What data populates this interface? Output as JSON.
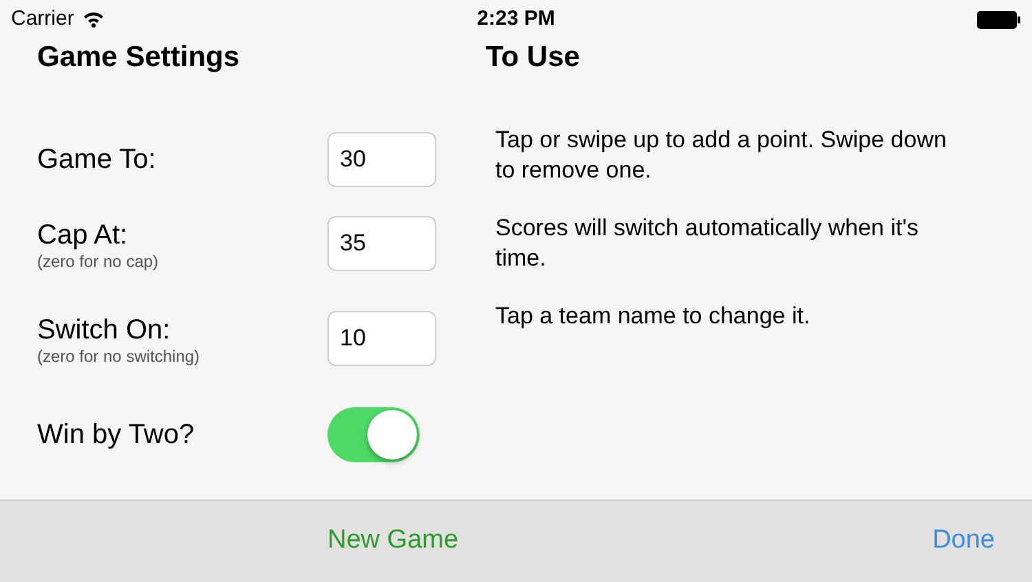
{
  "status_bar": {
    "carrier": "Carrier",
    "time": "2:23 PM"
  },
  "game_settings": {
    "title": "Game Settings",
    "rows": [
      {
        "kind": "number",
        "label": "Game To:",
        "value": "30"
      },
      {
        "kind": "number",
        "label": "Cap At:",
        "hint": "(zero for no cap)",
        "value": "35"
      },
      {
        "kind": "number",
        "label": "Switch On:",
        "hint": "(zero for no switching)",
        "value": "10"
      },
      {
        "kind": "toggle",
        "label": "Win by Two?",
        "on": true
      }
    ]
  },
  "to_use": {
    "title": "To Use",
    "paragraphs": [
      "Tap or swipe up to add a point. Swipe down to remove one.",
      "Scores will switch automatically when it's time.",
      "Tap a team name to change it."
    ]
  },
  "toolbar": {
    "new_game": "New Game",
    "done": "Done"
  }
}
